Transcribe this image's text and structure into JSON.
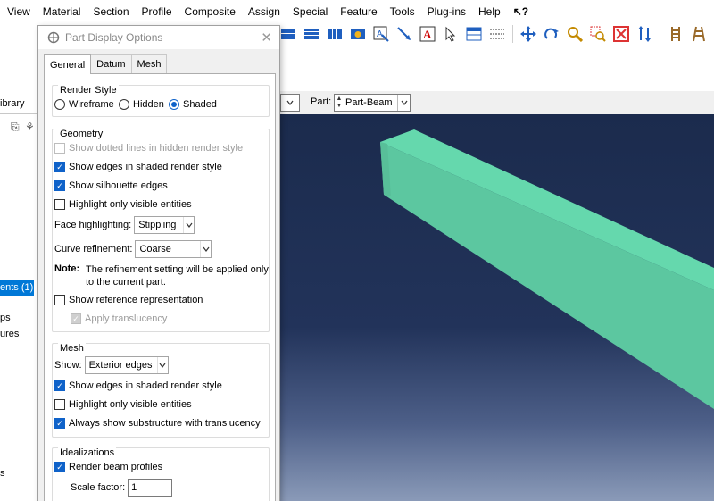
{
  "menubar": {
    "items": [
      "View",
      "Material",
      "Section",
      "Profile",
      "Composite",
      "Assign",
      "Special",
      "Feature",
      "Tools",
      "Plug-ins",
      "Help"
    ],
    "help_cursor": "↖?"
  },
  "toolbar": {
    "icons": [
      "view-layout-icon",
      "view-layout-icon",
      "view-layout-icon",
      "render-icon",
      "query-icon",
      "arrow-tool-icon",
      "text-annotation-icon",
      "select-pointer-icon",
      "table-icon",
      "list-icon",
      "pan-icon",
      "rotate-icon",
      "zoom-icon",
      "box-zoom-icon",
      "auto-fit-icon",
      "cycle-views-icon",
      "ladder-icon",
      "ladder-alt-icon"
    ]
  },
  "left_panel": {
    "library_tab": "ibrary",
    "selected_item": "ents (1)",
    "partial_items": [
      "ps",
      "ures",
      "s"
    ]
  },
  "context_bar": {
    "part_label": "Part:",
    "part_value": "Part-Beam"
  },
  "dialog": {
    "title": "Part Display Options",
    "tabs": [
      "General",
      "Datum",
      "Mesh"
    ],
    "active_tab": "General",
    "render_style": {
      "title": "Render Style",
      "options": [
        "Wireframe",
        "Hidden",
        "Shaded"
      ],
      "selected": "Shaded"
    },
    "geometry": {
      "title": "Geometry",
      "show_dotted_lines": "Show dotted lines in hidden render style",
      "show_edges_shaded": "Show edges in shaded render style",
      "show_silhouette": "Show silhouette edges",
      "highlight_visible": "Highlight only visible entities",
      "face_highlighting_label": "Face highlighting:",
      "face_highlighting_value": "Stippling",
      "curve_refinement_label": "Curve refinement:",
      "curve_refinement_value": "Coarse",
      "note_label": "Note:",
      "note_text": "The refinement setting will be applied only to the current part.",
      "show_reference": "Show reference representation",
      "apply_translucency": "Apply translucency"
    },
    "mesh": {
      "title": "Mesh",
      "show_label": "Show:",
      "show_value": "Exterior edges",
      "show_edges_shaded": "Show edges in shaded render style",
      "highlight_visible": "Highlight only visible entities",
      "always_show_substructure": "Always show substructure with translucency"
    },
    "idealizations": {
      "title": "Idealizations",
      "render_beam_profiles": "Render beam profiles",
      "scale_factor_label": "Scale factor:",
      "scale_factor_value": "1"
    },
    "states": {
      "show_dotted_lines": false,
      "show_edges_shaded": true,
      "show_silhouette": true,
      "geom_highlight_visible": false,
      "show_reference": false,
      "apply_translucency": true,
      "mesh_show_edges_shaded": true,
      "mesh_highlight_visible": false,
      "always_show_substructure": true,
      "render_beam_profiles": true
    }
  },
  "colors": {
    "beam_top": "#65d8ad",
    "beam_side": "#5cc7a0",
    "viewport_top": "#1b2b4d",
    "viewport_bottom": "#8a9ab8",
    "accent": "#0f62c9"
  }
}
